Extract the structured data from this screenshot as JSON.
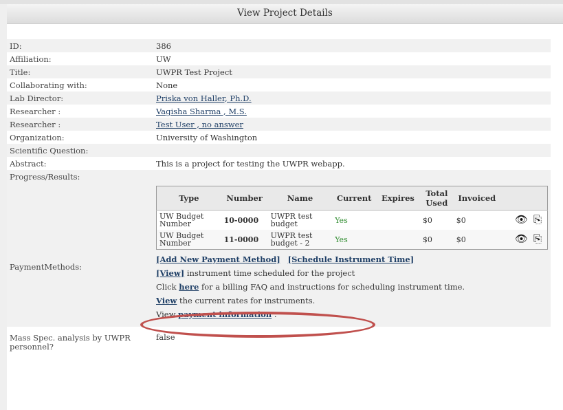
{
  "panel": {
    "title": "View Project Details"
  },
  "details": [
    {
      "label": "ID:",
      "value": "386",
      "link": false
    },
    {
      "label": "Affiliation:",
      "value": "UW",
      "link": false
    },
    {
      "label": "Title:",
      "value": "UWPR Test Project",
      "link": false
    },
    {
      "label": "Collaborating with:",
      "value": "None",
      "link": false
    },
    {
      "label": "Lab Director:",
      "value": "Priska von Haller, Ph.D.",
      "link": true
    },
    {
      "label": "Researcher :",
      "value": "Vagisha Sharma , M.S.",
      "link": true
    },
    {
      "label": "Researcher :",
      "value": "Test User , no  answer",
      "link": true
    },
    {
      "label": "Organization:",
      "value": "University of Washington",
      "link": false
    },
    {
      "label": "Scientific Question:",
      "value": "",
      "link": false
    },
    {
      "label": "Abstract:",
      "value": "This is a project for testing the UWPR webapp.",
      "link": false
    },
    {
      "label": "Progress/Results:",
      "value": "",
      "link": false
    }
  ],
  "payment": {
    "label": "PaymentMethods:",
    "headers": [
      "Type",
      "Number",
      "Name",
      "Current",
      "Expires",
      "Total Used",
      "Invoiced",
      ""
    ],
    "rows": [
      {
        "type": "UW Budget Number",
        "number": "10-0000",
        "name": "UWPR test budget",
        "current": "Yes",
        "expires": "",
        "total_used": "$0",
        "invoiced": "$0"
      },
      {
        "type": "UW Budget Number",
        "number": "11-0000",
        "name": "UWPR test budget - 2",
        "current": "Yes",
        "expires": "",
        "total_used": "$0",
        "invoiced": "$0"
      }
    ],
    "icons": {
      "view": "eye-icon",
      "edit": "edit-copy-icon"
    },
    "add_link": "[Add New Payment Method]",
    "schedule_link": "[Schedule Instrument Time]",
    "view_link": "[View]",
    "view_text": " instrument time scheduled for the project",
    "click_prefix": "Click ",
    "here_link": "here",
    "click_suffix": " for a billing FAQ and instructions for scheduling instrument time.",
    "rates_link": "View",
    "rates_text": " the current rates for instruments.",
    "payinfo_prefix": "View ",
    "payinfo_link": "payment information",
    "payinfo_suffix": " ."
  },
  "mass_spec": {
    "label": "Mass Spec. analysis by UWPR personnel?",
    "value": "false"
  },
  "annotation": {
    "color": "#c0504d"
  }
}
